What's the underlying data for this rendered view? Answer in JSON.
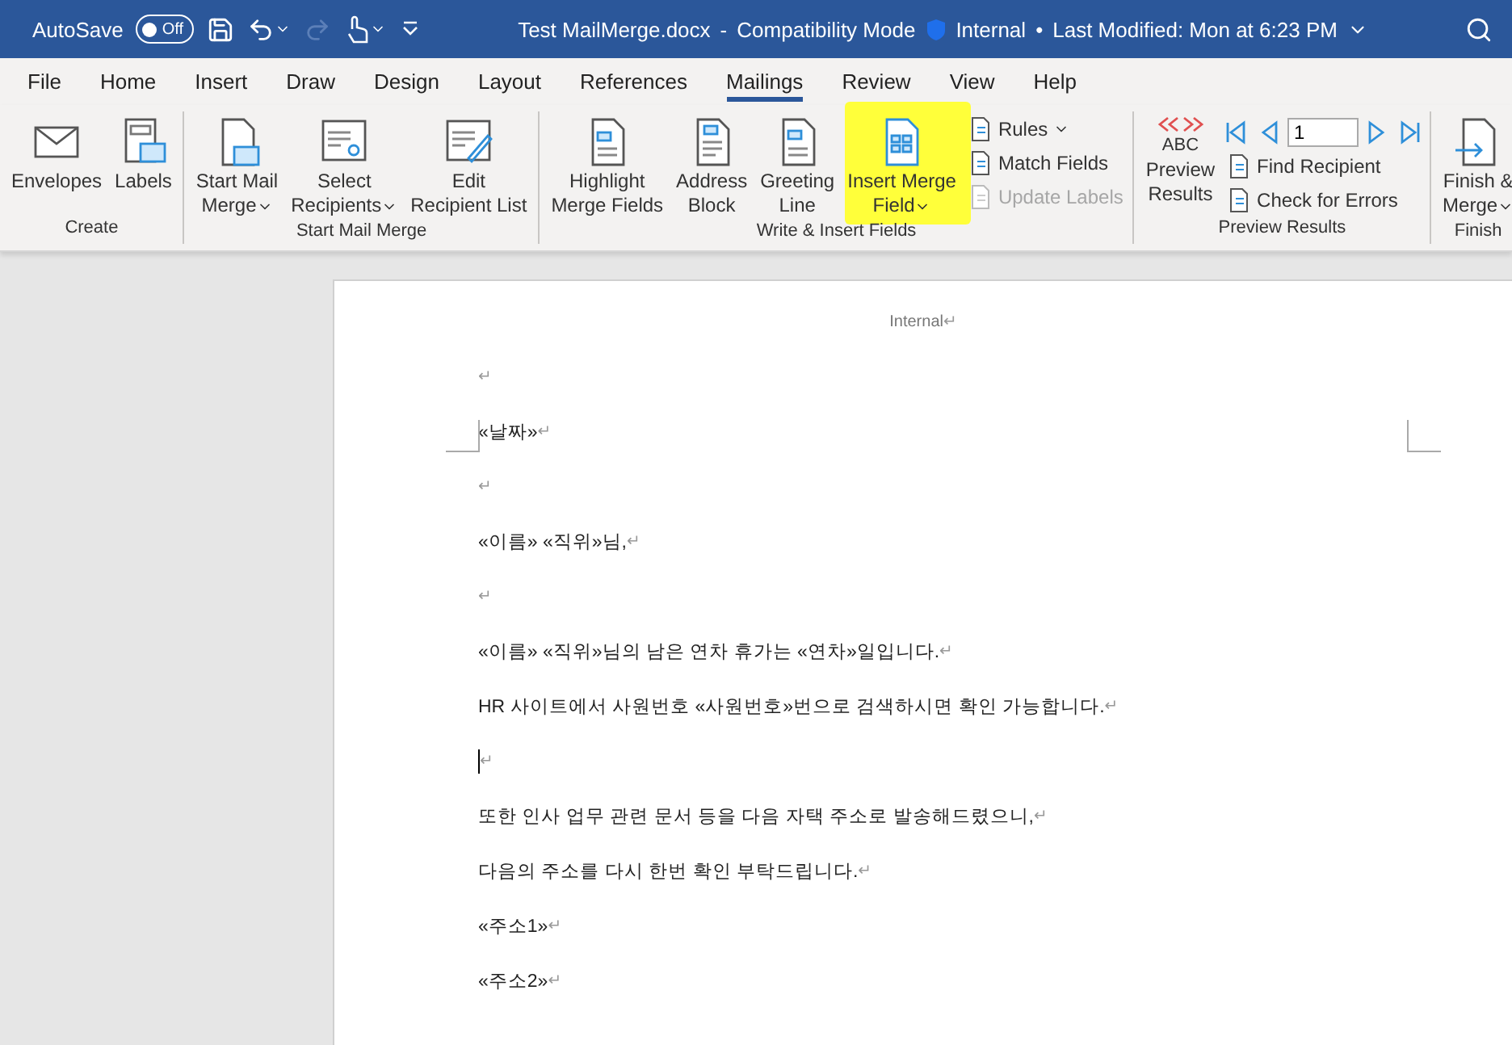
{
  "title_bar": {
    "autosave_label": "AutoSave",
    "autosave_toggle": {
      "label": "Off",
      "on": false
    },
    "document_title": "Test MailMerge.docx",
    "separator": "-",
    "mode": "Compatibility Mode",
    "sensitivity": "Internal",
    "bullet": "•",
    "last_modified": "Last Modified: Mon at 6:23 PM"
  },
  "tabs": [
    {
      "label": "File",
      "selected": false
    },
    {
      "label": "Home",
      "selected": false
    },
    {
      "label": "Insert",
      "selected": false
    },
    {
      "label": "Draw",
      "selected": false
    },
    {
      "label": "Design",
      "selected": false
    },
    {
      "label": "Layout",
      "selected": false
    },
    {
      "label": "References",
      "selected": false
    },
    {
      "label": "Mailings",
      "selected": true
    },
    {
      "label": "Review",
      "selected": false
    },
    {
      "label": "View",
      "selected": false
    },
    {
      "label": "Help",
      "selected": false
    }
  ],
  "ribbon": [
    {
      "label": "Create",
      "items": [
        {
          "kind": "large",
          "lines": [
            "Envelopes"
          ],
          "dropdown": false
        },
        {
          "kind": "large",
          "lines": [
            "Labels"
          ],
          "dropdown": false
        }
      ]
    },
    {
      "label": "Start Mail Merge",
      "items": [
        {
          "kind": "large",
          "lines": [
            "Start Mail",
            "Merge"
          ],
          "dropdown": true
        },
        {
          "kind": "large",
          "lines": [
            "Select",
            "Recipients"
          ],
          "dropdown": true
        },
        {
          "kind": "large",
          "lines": [
            "Edit",
            "Recipient List"
          ],
          "dropdown": false
        }
      ]
    },
    {
      "label": "Write & Insert Fields",
      "items": [
        {
          "kind": "large",
          "lines": [
            "Highlight",
            "Merge Fields"
          ],
          "dropdown": false
        },
        {
          "kind": "large",
          "lines": [
            "Address",
            "Block"
          ],
          "dropdown": false
        },
        {
          "kind": "large",
          "lines": [
            "Greeting",
            "Line"
          ],
          "dropdown": false
        },
        {
          "kind": "large",
          "lines": [
            "Insert Merge",
            "Field"
          ],
          "dropdown": true,
          "highlighted": true
        },
        {
          "kind": "stack",
          "buttons": [
            {
              "label": "Rules",
              "dropdown": true,
              "disabled": false
            },
            {
              "label": "Match Fields",
              "dropdown": false,
              "disabled": false
            },
            {
              "label": "Update Labels",
              "dropdown": false,
              "disabled": true
            }
          ]
        }
      ]
    },
    {
      "label": "Preview Results",
      "items": [
        {
          "kind": "large",
          "lines": [
            "Preview",
            "Results"
          ],
          "dropdown": false,
          "caption": "ABC"
        },
        {
          "kind": "navigator",
          "record": "1",
          "buttons": [
            {
              "label": "Find Recipient",
              "dropdown": false,
              "disabled": false
            },
            {
              "label": "Check for Errors",
              "dropdown": false,
              "disabled": false
            }
          ]
        }
      ]
    },
    {
      "label": "Finish",
      "items": [
        {
          "kind": "large",
          "lines": [
            "Finish &",
            "Merge"
          ],
          "dropdown": true
        }
      ]
    }
  ],
  "document": {
    "header": "Internal",
    "return_mark": "↵",
    "paragraphs": [
      {
        "cursor": false
      },
      {
        "text": "«날짜»",
        "cursor": false
      },
      {
        "cursor": false
      },
      {
        "text": "«이름» «직위»님, ",
        "cursor": false
      },
      {
        "cursor": false
      },
      {
        "text": "«이름» «직위»님의 남은 연차 휴가는 «연차»일입니다. ",
        "cursor": false
      },
      {
        "text": "HR 사이트에서 사원번호 «사원번호»번으로 검색하시면 확인 가능합니다. ",
        "cursor": false
      },
      {
        "cursor": true
      },
      {
        "text": "또한 인사 업무 관련 문서 등을 다음 자택 주소로 발송해드렸으니, ",
        "cursor": false
      },
      {
        "text": "다음의 주소를 다시 한번 확인 부탁드립니다. ",
        "cursor": false
      },
      {
        "text": "«주소1»",
        "cursor": false
      },
      {
        "text": "«주소2»",
        "cursor": false
      }
    ]
  }
}
